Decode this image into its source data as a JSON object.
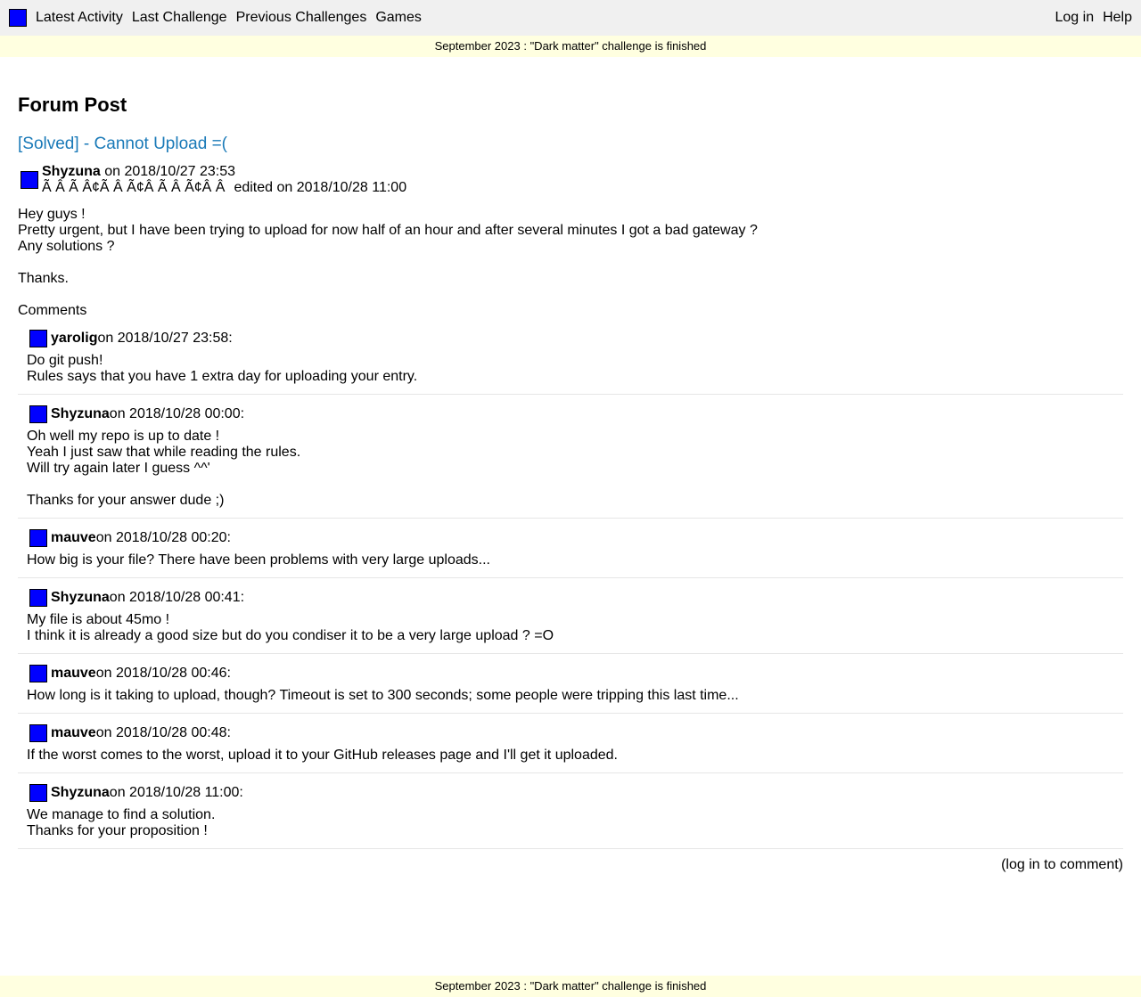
{
  "nav": {
    "logo_icon": "blue-square-logo",
    "links": [
      "Latest Activity",
      "Last Challenge",
      "Previous Challenges",
      "Games"
    ],
    "login": "Log in",
    "help": "Help"
  },
  "banner": "September 2023 : \"Dark matter\" challenge is finished",
  "page_title": "Forum Post",
  "post": {
    "title": "[Solved] - Cannot Upload =(",
    "author": "Shyzuna",
    "posted": " on 2018/10/27 23:53",
    "garbled": "Ã    Â    Ã    Â¢Ã    Â    Ã¢Â    Ã    Â    Ã¢Â    Â",
    "edited": "edited on 2018/10/28 11:00",
    "body_lines": [
      "Hey guys !",
      "Pretty urgent, but I have been trying to upload for now half of an hour and after several minutes I got a bad gateway ?",
      "Any solutions ?"
    ],
    "thanks": "Thanks."
  },
  "comments_heading": "Comments",
  "comments": [
    {
      "author": "yarolig",
      "when": " on 2018/10/27 23:58:",
      "lines": [
        "Do git push!",
        "Rules says that you have 1 extra day for uploading your entry."
      ]
    },
    {
      "author": "Shyzuna",
      "when": " on 2018/10/28 00:00:",
      "lines": [
        "Oh well my repo is up to date !",
        "Yeah I just saw that while reading the rules.",
        "Will try again later I guess ^^'"
      ],
      "extra": "Thanks for your answer dude ;)"
    },
    {
      "author": "mauve",
      "when": " on 2018/10/28 00:20:",
      "lines": [
        "How big is your file? There have been problems with very large uploads..."
      ]
    },
    {
      "author": "Shyzuna",
      "when": " on 2018/10/28 00:41:",
      "lines": [
        "My file is about 45mo !",
        "I think it is already a good size but do you condiser it to be a very large upload ? =O"
      ]
    },
    {
      "author": "mauve",
      "when": " on 2018/10/28 00:46:",
      "lines": [
        "How long is it taking to upload, though? Timeout is set to 300 seconds; some people were tripping this last time..."
      ]
    },
    {
      "author": "mauve",
      "when": " on 2018/10/28 00:48:",
      "lines": [
        "If the worst comes to the worst, upload it to your GitHub releases page and I'll get it uploaded."
      ]
    },
    {
      "author": "Shyzuna",
      "when": " on 2018/10/28 11:00:",
      "lines": [
        "We manage to find a solution.",
        "Thanks for your proposition !"
      ]
    }
  ],
  "login_to_comment": "(log in to comment)",
  "footer_banner": "September 2023 : \"Dark matter\" challenge is finished",
  "colors": {
    "avatar": "#0000ff",
    "link": "#1a7ab8",
    "banner_bg": "#ffffe0",
    "nav_bg": "#f0f0f0"
  }
}
